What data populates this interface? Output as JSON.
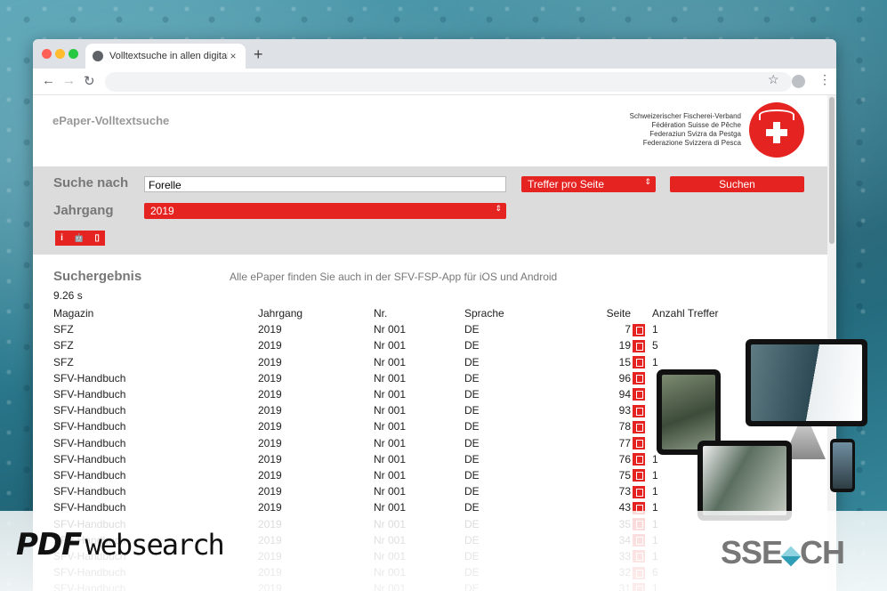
{
  "browser": {
    "tab_title": "Volltextsuche in allen digitalen M",
    "close_glyph": "×",
    "newtab_glyph": "+",
    "back_glyph": "←",
    "forward_glyph": "→",
    "reload_glyph": "↻",
    "star_glyph": "☆",
    "menu_glyph": "⋮"
  },
  "header": {
    "app_title": "ePaper-Volltextsuche",
    "org_lines": [
      "Schweizerischer Fischerei-Verband",
      "Fédération Suisse de Pêche",
      "Federaziun Svizra da Pestga",
      "Federazione Svizzera di Pesca"
    ]
  },
  "search": {
    "label_search": "Suche nach",
    "query": "Forelle",
    "label_year": "Jahrgang",
    "year_value": "2019",
    "per_page_label": "Treffer pro Seite",
    "submit_label": "Suchen",
    "select_arrow": "⇕",
    "app_icons": [
      "i",
      "🤖",
      "▯"
    ]
  },
  "results": {
    "title": "Suchergebnis",
    "note": "Alle ePaper finden Sie auch in der SFV-FSP-App für iOS und Android",
    "time": "9.26 s",
    "columns": [
      "Magazin",
      "Jahrgang",
      "Nr.",
      "Sprache",
      "Seite",
      "Anzahl Treffer"
    ],
    "rows": [
      {
        "magazin": "SFZ",
        "jahrgang": "2019",
        "nr": "Nr 001",
        "sprache": "DE",
        "seite": "7",
        "treffer": "1"
      },
      {
        "magazin": "SFZ",
        "jahrgang": "2019",
        "nr": "Nr 001",
        "sprache": "DE",
        "seite": "19",
        "treffer": "5"
      },
      {
        "magazin": "SFZ",
        "jahrgang": "2019",
        "nr": "Nr 001",
        "sprache": "DE",
        "seite": "15",
        "treffer": "1"
      },
      {
        "magazin": "SFV-Handbuch",
        "jahrgang": "2019",
        "nr": "Nr 001",
        "sprache": "DE",
        "seite": "96",
        "treffer": ""
      },
      {
        "magazin": "SFV-Handbuch",
        "jahrgang": "2019",
        "nr": "Nr 001",
        "sprache": "DE",
        "seite": "94",
        "treffer": ""
      },
      {
        "magazin": "SFV-Handbuch",
        "jahrgang": "2019",
        "nr": "Nr 001",
        "sprache": "DE",
        "seite": "93",
        "treffer": ""
      },
      {
        "magazin": "SFV-Handbuch",
        "jahrgang": "2019",
        "nr": "Nr 001",
        "sprache": "DE",
        "seite": "78",
        "treffer": ""
      },
      {
        "magazin": "SFV-Handbuch",
        "jahrgang": "2019",
        "nr": "Nr 001",
        "sprache": "DE",
        "seite": "77",
        "treffer": ""
      },
      {
        "magazin": "SFV-Handbuch",
        "jahrgang": "2019",
        "nr": "Nr 001",
        "sprache": "DE",
        "seite": "76",
        "treffer": "1"
      },
      {
        "magazin": "SFV-Handbuch",
        "jahrgang": "2019",
        "nr": "Nr 001",
        "sprache": "DE",
        "seite": "75",
        "treffer": "1"
      },
      {
        "magazin": "SFV-Handbuch",
        "jahrgang": "2019",
        "nr": "Nr 001",
        "sprache": "DE",
        "seite": "73",
        "treffer": "1"
      },
      {
        "magazin": "SFV-Handbuch",
        "jahrgang": "2019",
        "nr": "Nr 001",
        "sprache": "DE",
        "seite": "43",
        "treffer": "1"
      },
      {
        "magazin": "SFV-Handbuch",
        "jahrgang": "2019",
        "nr": "Nr 001",
        "sprache": "DE",
        "seite": "35",
        "treffer": "1"
      },
      {
        "magazin": "SFV-Handbuch",
        "jahrgang": "2019",
        "nr": "Nr 001",
        "sprache": "DE",
        "seite": "34",
        "treffer": "1"
      },
      {
        "magazin": "SFV-Handbuch",
        "jahrgang": "2019",
        "nr": "Nr 001",
        "sprache": "DE",
        "seite": "33",
        "treffer": "1"
      },
      {
        "magazin": "SFV-Handbuch",
        "jahrgang": "2019",
        "nr": "Nr 001",
        "sprache": "DE",
        "seite": "32",
        "treffer": "6"
      },
      {
        "magazin": "SFV-Handbuch",
        "jahrgang": "2019",
        "nr": "Nr 001",
        "sprache": "DE",
        "seite": "31",
        "treffer": "1"
      }
    ]
  },
  "branding": {
    "pdf_word": "PDF",
    "websearch_word": "websearch",
    "sse_left": "SSE",
    "sse_right": "CH"
  },
  "colors": {
    "accent_red": "#e52421",
    "panel_gray": "#dcdcdc"
  }
}
